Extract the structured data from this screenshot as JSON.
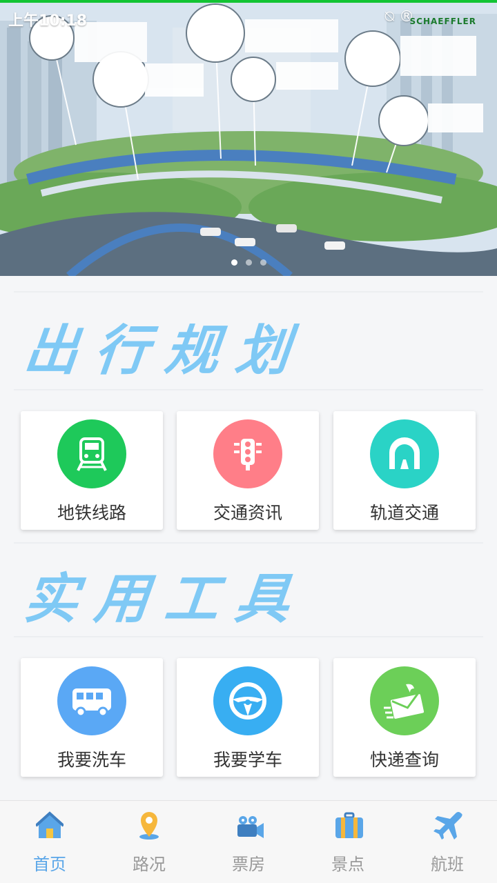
{
  "status_bar": {
    "time": "上午10:18",
    "icons": "⍉ ®"
  },
  "banner": {
    "brand": "SCHAEFFLER",
    "slides": 3,
    "active_slide": 0
  },
  "sections": [
    {
      "title": "出行规划",
      "items": [
        {
          "label": "地铁线路",
          "icon": "train-icon",
          "color": "#1ec95a"
        },
        {
          "label": "交通资讯",
          "icon": "traffic-light-icon",
          "color": "#ff7e88"
        },
        {
          "label": "轨道交通",
          "icon": "tunnel-icon",
          "color": "#2ad3c6"
        }
      ]
    },
    {
      "title": "实用工具",
      "items": [
        {
          "label": "我要洗车",
          "icon": "bus-icon",
          "color": "#5aa8f5"
        },
        {
          "label": "我要学车",
          "icon": "steering-wheel-icon",
          "color": "#38aef2"
        },
        {
          "label": "快递查询",
          "icon": "envelope-icon",
          "color": "#6ccf58"
        }
      ]
    }
  ],
  "nav": [
    {
      "label": "首页",
      "icon": "home-icon",
      "active": true
    },
    {
      "label": "路况",
      "icon": "location-pin-icon",
      "active": false
    },
    {
      "label": "票房",
      "icon": "video-camera-icon",
      "active": false
    },
    {
      "label": "景点",
      "icon": "suitcase-icon",
      "active": false
    },
    {
      "label": "航班",
      "icon": "airplane-icon",
      "active": false
    }
  ]
}
